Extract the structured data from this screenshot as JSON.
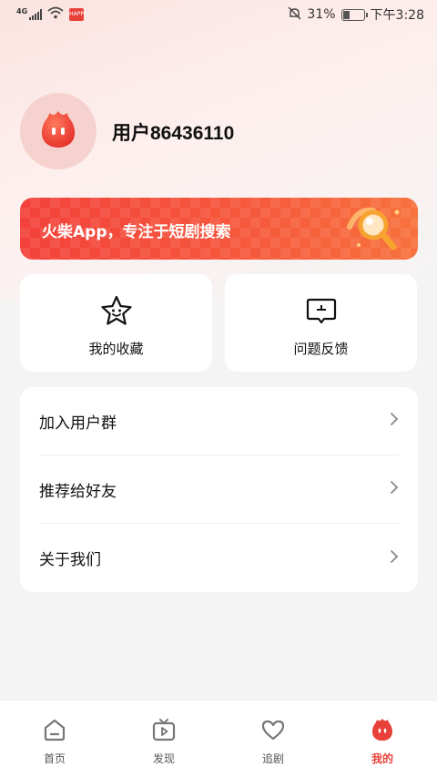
{
  "status_bar": {
    "network": "4G",
    "app_badge": "HAPPY",
    "battery_percent": "31%",
    "time": "下午3:28",
    "icons": [
      "signal-icon",
      "wifi-icon",
      "mute-bell-icon",
      "battery-icon"
    ]
  },
  "profile": {
    "username": "用户86436110",
    "avatar_icon": "flame-mascot-icon"
  },
  "banner": {
    "text": "火柴App，专注于短剧搜索",
    "icon": "magnifier-illustration-icon"
  },
  "quick_actions": [
    {
      "label": "我的收藏",
      "icon": "star-face-icon"
    },
    {
      "label": "问题反馈",
      "icon": "feedback-message-icon"
    }
  ],
  "menu": {
    "items": [
      {
        "label": "加入用户群"
      },
      {
        "label": "推荐给好友"
      },
      {
        "label": "关于我们"
      }
    ],
    "chevron_icon": "chevron-right-icon"
  },
  "bottom_nav": {
    "items": [
      {
        "label": "首页",
        "icon": "home-icon"
      },
      {
        "label": "发现",
        "icon": "tv-play-icon"
      },
      {
        "label": "追剧",
        "icon": "heart-icon"
      },
      {
        "label": "我的",
        "icon": "flame-mascot-icon"
      }
    ],
    "active": "我的"
  },
  "colors": {
    "accent": "#e8413a",
    "banner_start": "#f3413b",
    "banner_end": "#f7723d",
    "page_bg": "#f4f4f5"
  }
}
